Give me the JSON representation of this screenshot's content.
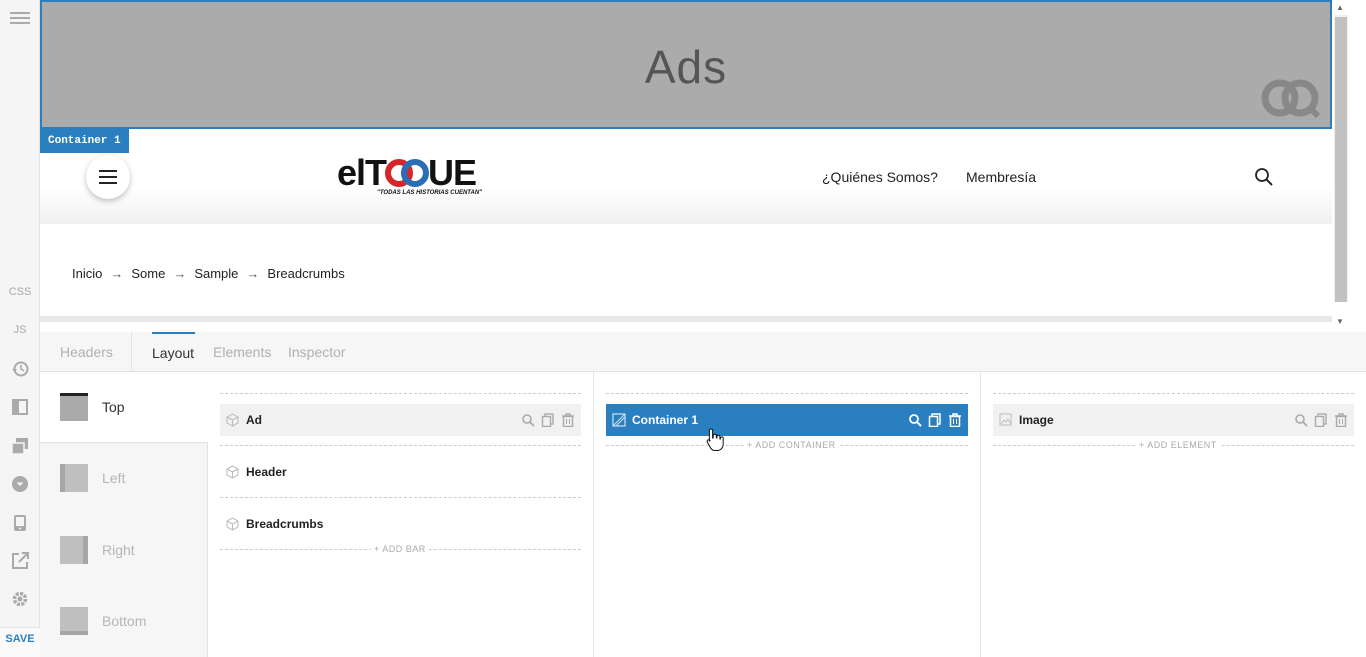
{
  "sidebar": {
    "items": [
      {
        "name": "menu-icon"
      },
      {
        "label": "CSS"
      },
      {
        "label": "JS"
      },
      {
        "name": "history-icon"
      },
      {
        "name": "sidebar-layout-icon"
      },
      {
        "name": "copy-layers-icon"
      },
      {
        "name": "dropdown-circle-icon"
      },
      {
        "name": "mobile-device-icon"
      },
      {
        "name": "external-link-icon"
      },
      {
        "name": "gear-icon"
      }
    ],
    "save_label": "SAVE"
  },
  "preview": {
    "ad_text": "Ads",
    "container_tag": "Container 1",
    "logo_text_left": "el",
    "logo_text_right": "UE",
    "logo_tagline": "\"TODAS LAS HISTORIAS CUENTAN\"",
    "nav": [
      "¿Quiénes Somos?",
      "Membresía"
    ],
    "breadcrumbs": [
      "Inicio",
      "Some",
      "Sample",
      "Breadcrumbs"
    ],
    "breadcrumb_separator": "→"
  },
  "tabs": {
    "items": [
      "Headers",
      "Layout",
      "Elements",
      "Inspector"
    ],
    "active": "Layout"
  },
  "layout_positions": [
    {
      "label": "Top",
      "active": true
    },
    {
      "label": "Left"
    },
    {
      "label": "Right"
    },
    {
      "label": "Bottom"
    }
  ],
  "bars": {
    "items": [
      "Ad",
      "Header",
      "Breadcrumbs"
    ],
    "add_label": "+ ADD BAR"
  },
  "containers": {
    "items": [
      "Container 1"
    ],
    "add_label": "+ ADD CONTAINER"
  },
  "elements": {
    "items": [
      "Image"
    ],
    "add_label": "+ ADD ELEMENT"
  },
  "colors": {
    "accent": "#2a7fc1",
    "ad_background": "#ababab"
  }
}
